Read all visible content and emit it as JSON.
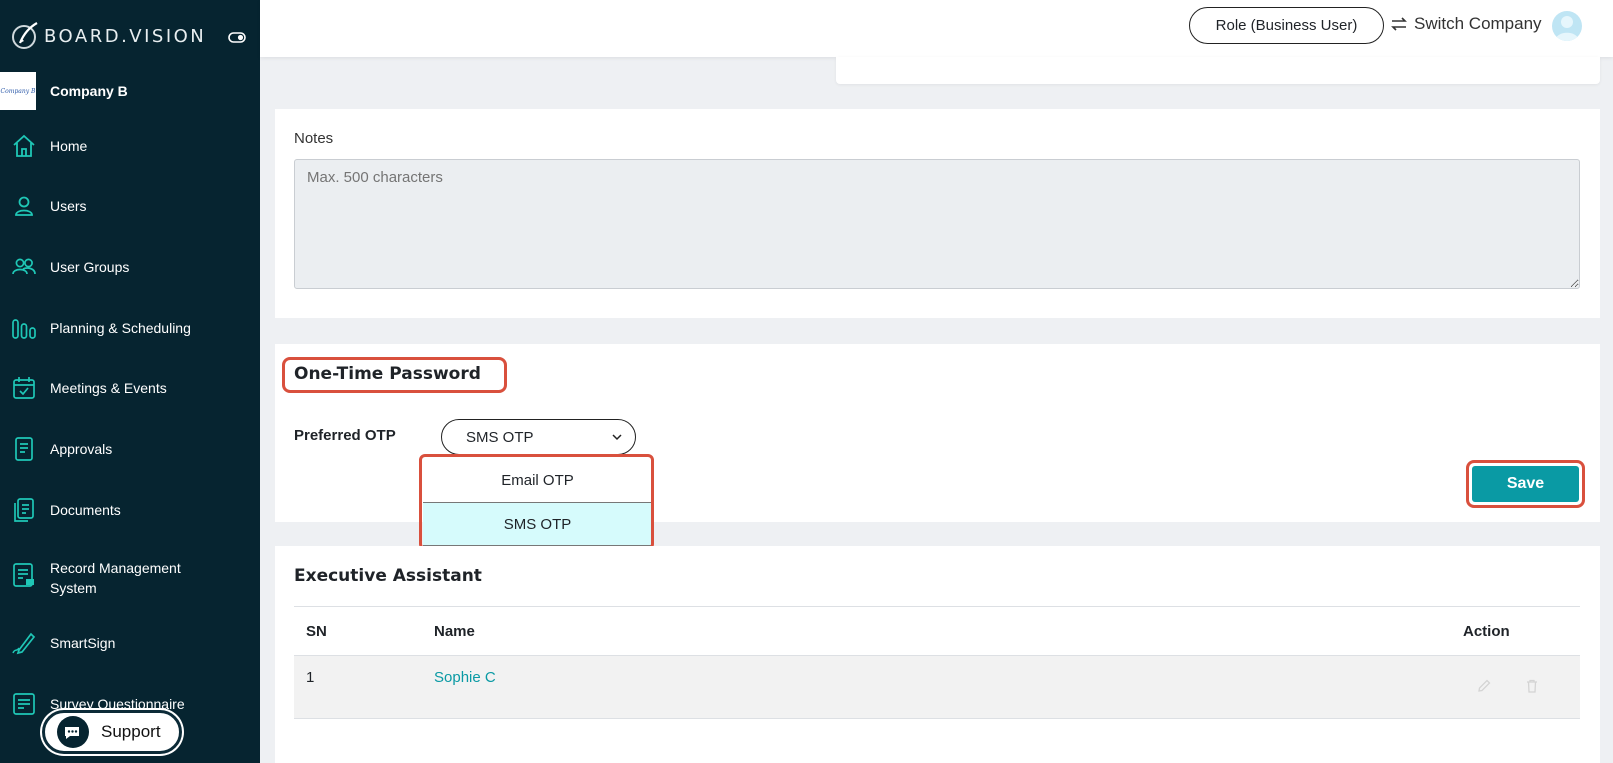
{
  "app": {
    "brand": "BOARD.VISION",
    "company_logo_text": "Company B",
    "company_name": "Company B"
  },
  "colors": {
    "sidebar_bg": "#062430",
    "accent": "#0a9aa4",
    "highlight": "#d9503d",
    "selected_option_bg": "#d6fbfc"
  },
  "sidebar": {
    "items": [
      {
        "label": "Home",
        "icon": "home-icon"
      },
      {
        "label": "Users",
        "icon": "user-icon"
      },
      {
        "label": "User Groups",
        "icon": "user-group-icon"
      },
      {
        "label": "Planning & Scheduling",
        "icon": "bar-chart-icon"
      },
      {
        "label": "Meetings & Events",
        "icon": "calendar-check-icon"
      },
      {
        "label": "Approvals",
        "icon": "document-list-icon"
      },
      {
        "label": "Documents",
        "icon": "documents-icon"
      },
      {
        "label": "Record Management System",
        "icon": "record-icon"
      },
      {
        "label": "SmartSign",
        "icon": "pen-icon"
      },
      {
        "label": "Survey Questionnaire",
        "icon": "survey-icon"
      }
    ],
    "support_label": "Support"
  },
  "header": {
    "role_button": "Role (Business User)",
    "switch_company": "Switch Company"
  },
  "notes": {
    "label": "Notes",
    "placeholder": "Max. 500 characters",
    "value": ""
  },
  "otp": {
    "title": "One-Time Password",
    "preferred_label": "Preferred OTP",
    "selected": "SMS OTP",
    "options": [
      "Email OTP",
      "SMS OTP"
    ],
    "save_label": "Save"
  },
  "executive_assistant": {
    "title": "Executive Assistant",
    "columns": [
      "SN",
      "Name",
      "Action"
    ],
    "rows": [
      {
        "sn": "1",
        "name": "Sophie C"
      }
    ]
  }
}
